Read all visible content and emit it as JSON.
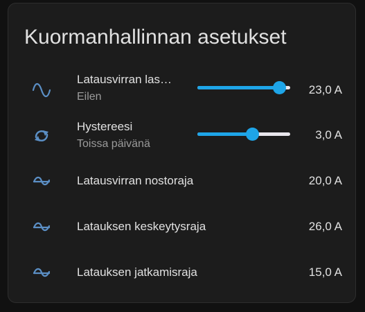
{
  "card": {
    "title": "Kuormanhallinnan asetukset"
  },
  "rows": [
    {
      "icon": "sine-wave-icon",
      "name": "Latausvirran las…",
      "secondary": "Eilen",
      "value": "23,0 A",
      "slider_fraction": 0.88
    },
    {
      "icon": "swap-arrows-icon",
      "name": "Hystereesi",
      "secondary": "Toissa päivänä",
      "value": "3,0 A",
      "slider_fraction": 0.59
    },
    {
      "icon": "tilde-wave-icon",
      "name": "Latausvirran nostoraja",
      "value": "20,0 A"
    },
    {
      "icon": "tilde-wave-icon",
      "name": "Latauksen keskeytysraja",
      "value": "26,0 A"
    },
    {
      "icon": "tilde-wave-icon",
      "name": "Latauksen jatkamisraja",
      "value": "15,0 A"
    }
  ],
  "colors": {
    "accent": "#1ea5e8",
    "icon": "#5b8fc5",
    "card_background": "#1c1c1c",
    "page_background": "#111111",
    "track": "#e8e6ec",
    "secondary_text": "#9b9b9b"
  }
}
